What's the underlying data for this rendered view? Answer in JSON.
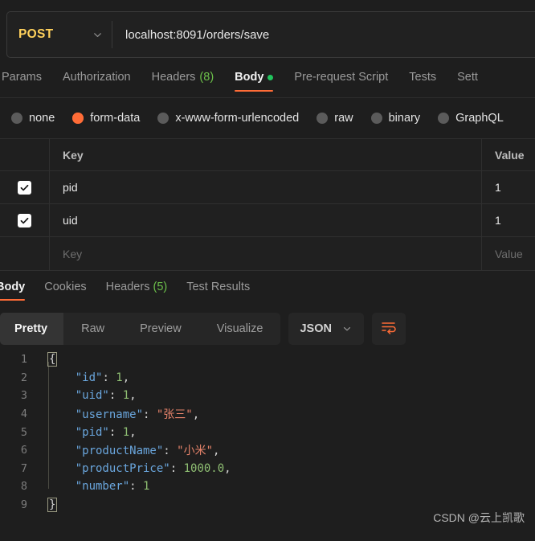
{
  "request": {
    "method": "POST",
    "url": "localhost:8091/orders/save",
    "tabs": [
      {
        "label": "Params",
        "active": false
      },
      {
        "label": "Authorization",
        "active": false
      },
      {
        "label": "Headers",
        "count": "(8)",
        "active": false
      },
      {
        "label": "Body",
        "active": true,
        "dot": true
      },
      {
        "label": "Pre-request Script",
        "active": false
      },
      {
        "label": "Tests",
        "active": false
      },
      {
        "label": "Sett",
        "active": false
      }
    ],
    "body_types": [
      {
        "label": "none",
        "checked": false
      },
      {
        "label": "form-data",
        "checked": true
      },
      {
        "label": "x-www-form-urlencoded",
        "checked": false
      },
      {
        "label": "raw",
        "checked": false
      },
      {
        "label": "binary",
        "checked": false
      },
      {
        "label": "GraphQL",
        "checked": false
      }
    ],
    "form_data": {
      "headers": {
        "key": "Key",
        "value": "Value"
      },
      "rows": [
        {
          "checked": true,
          "key": "pid",
          "value": "1",
          "placeholder": false
        },
        {
          "checked": true,
          "key": "uid",
          "value": "1",
          "placeholder": false
        },
        {
          "checked": false,
          "key": "Key",
          "value": "Value",
          "placeholder": true
        }
      ]
    }
  },
  "response": {
    "tabs": [
      {
        "label": "Body",
        "active": true
      },
      {
        "label": "Cookies",
        "active": false
      },
      {
        "label": "Headers",
        "count": "(5)",
        "active": false
      },
      {
        "label": "Test Results",
        "active": false
      }
    ],
    "viewer": {
      "modes": [
        {
          "label": "Pretty",
          "active": true
        },
        {
          "label": "Raw",
          "active": false
        },
        {
          "label": "Preview",
          "active": false
        },
        {
          "label": "Visualize",
          "active": false
        }
      ],
      "format": "JSON",
      "wrap_icon": "word-wrap-icon"
    },
    "code_lines": [
      {
        "n": "1",
        "tokens": [
          {
            "t": "{",
            "c": "brace"
          }
        ]
      },
      {
        "n": "2",
        "tokens": [
          {
            "t": "    ",
            "c": "p"
          },
          {
            "t": "\"id\"",
            "c": "k"
          },
          {
            "t": ": ",
            "c": "p"
          },
          {
            "t": "1",
            "c": "num"
          },
          {
            "t": ",",
            "c": "p"
          }
        ]
      },
      {
        "n": "3",
        "tokens": [
          {
            "t": "    ",
            "c": "p"
          },
          {
            "t": "\"uid\"",
            "c": "k"
          },
          {
            "t": ": ",
            "c": "p"
          },
          {
            "t": "1",
            "c": "num"
          },
          {
            "t": ",",
            "c": "p"
          }
        ]
      },
      {
        "n": "4",
        "tokens": [
          {
            "t": "    ",
            "c": "p"
          },
          {
            "t": "\"username\"",
            "c": "k"
          },
          {
            "t": ": ",
            "c": "p"
          },
          {
            "t": "\"张三\"",
            "c": "str"
          },
          {
            "t": ",",
            "c": "p"
          }
        ]
      },
      {
        "n": "5",
        "tokens": [
          {
            "t": "    ",
            "c": "p"
          },
          {
            "t": "\"pid\"",
            "c": "k"
          },
          {
            "t": ": ",
            "c": "p"
          },
          {
            "t": "1",
            "c": "num"
          },
          {
            "t": ",",
            "c": "p"
          }
        ]
      },
      {
        "n": "6",
        "tokens": [
          {
            "t": "    ",
            "c": "p"
          },
          {
            "t": "\"productName\"",
            "c": "k"
          },
          {
            "t": ": ",
            "c": "p"
          },
          {
            "t": "\"小米\"",
            "c": "str"
          },
          {
            "t": ",",
            "c": "p"
          }
        ]
      },
      {
        "n": "7",
        "tokens": [
          {
            "t": "    ",
            "c": "p"
          },
          {
            "t": "\"productPrice\"",
            "c": "k"
          },
          {
            "t": ": ",
            "c": "p"
          },
          {
            "t": "1000.0",
            "c": "num"
          },
          {
            "t": ",",
            "c": "p"
          }
        ]
      },
      {
        "n": "8",
        "tokens": [
          {
            "t": "    ",
            "c": "p"
          },
          {
            "t": "\"number\"",
            "c": "k"
          },
          {
            "t": ": ",
            "c": "p"
          },
          {
            "t": "1",
            "c": "num"
          }
        ]
      },
      {
        "n": "9",
        "tokens": [
          {
            "t": "}",
            "c": "brace"
          }
        ]
      }
    ],
    "response_json": {
      "id": 1,
      "uid": 1,
      "username": "张三",
      "pid": 1,
      "productName": "小米",
      "productPrice": 1000.0,
      "number": 1
    }
  },
  "watermark": "CSDN @云上凯歌",
  "colors": {
    "accent": "#ff6c37",
    "method": "#ffd15c",
    "badge_green": "#6cc04a",
    "json_key": "#6aa6dd",
    "json_string": "#e8846b",
    "json_number": "#8fbf73",
    "background": "#1e1e1e"
  }
}
